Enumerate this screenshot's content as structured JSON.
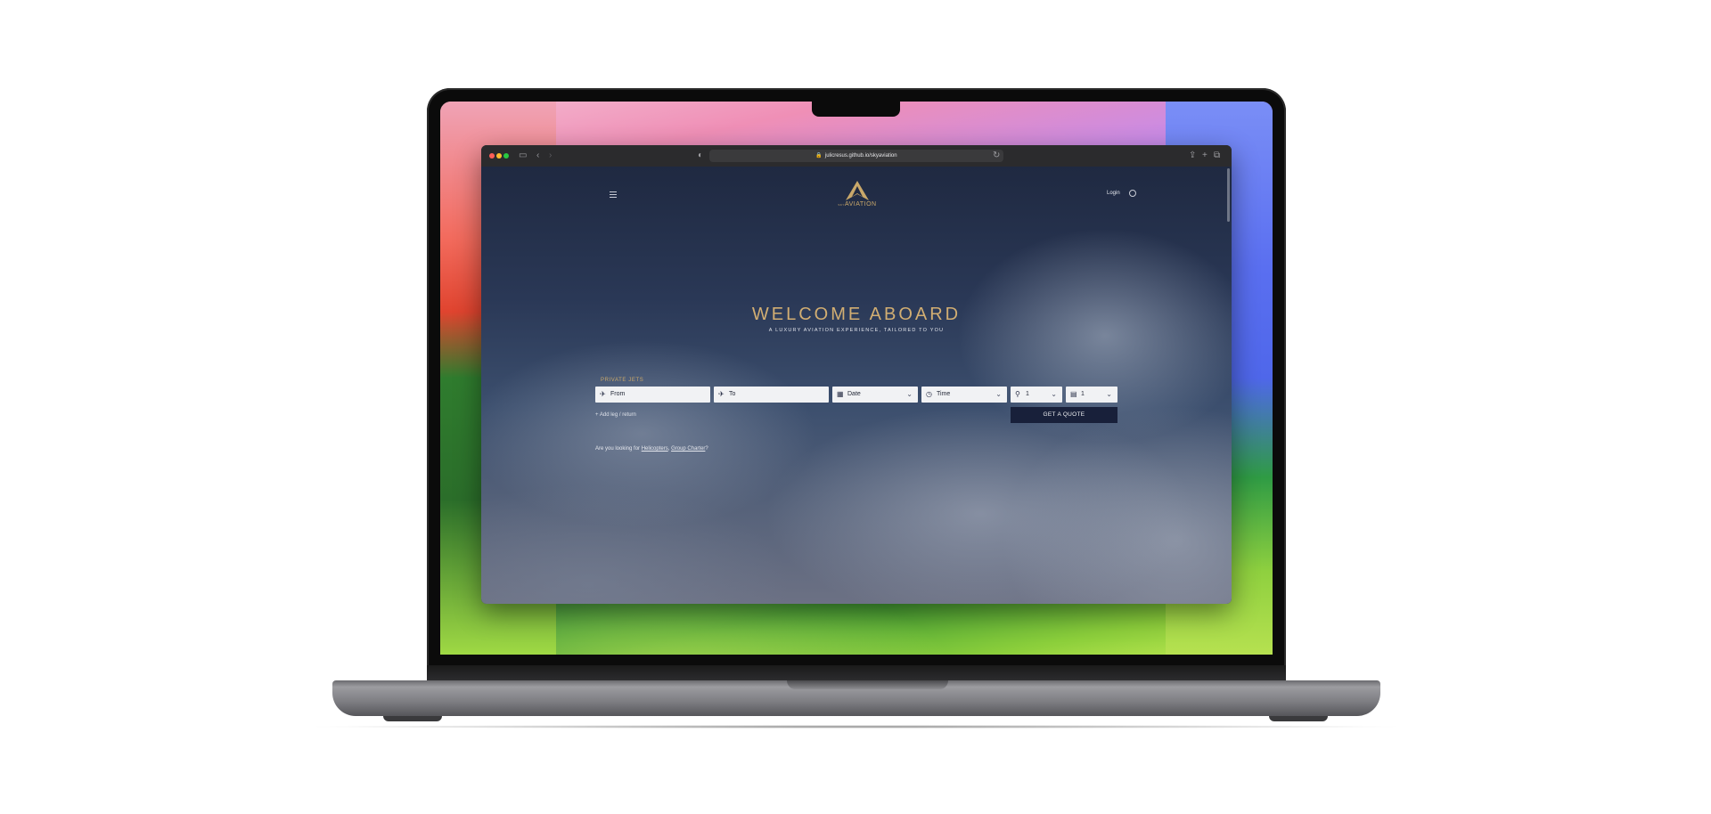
{
  "browser": {
    "url": "julicresus.github.io/skyaviation"
  },
  "header": {
    "logo_text": "AVIATION",
    "logo_prefix": "SKY",
    "login_label": "Login"
  },
  "hero": {
    "title": "WELCOME ABOARD",
    "subtitle": "A LUXURY AVIATION EXPERIENCE, TAILORED TO YOU"
  },
  "booking": {
    "section_label": "PRIVATE JETS",
    "from_label": "From",
    "to_label": "To",
    "date_label": "Date",
    "time_label": "Time",
    "passengers_value": "1",
    "luggage_value": "1",
    "add_leg_label": "Add leg / return",
    "quote_button": "GET A QUOTE"
  },
  "footer_prompt": {
    "prefix": "Are you looking for",
    "link_helicopters": "Helicopters",
    "separator": ",",
    "link_group_charter": "Group Charter",
    "suffix": "?"
  },
  "colors": {
    "accent_gold": "#d2ae72",
    "button_navy": "#18203a"
  }
}
